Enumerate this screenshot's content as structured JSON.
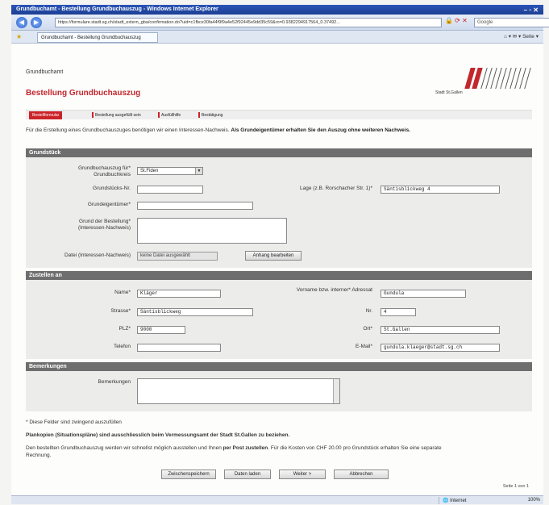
{
  "browser": {
    "title": "Grundbuchamt - Bestellung Grundbuchauszug - Windows Internet Explorer",
    "url": "https://formulare.stadt.sg.ch/stadt_extern_gba/confirmation.do?uid=c1fbce30fa44f9f9a4e52f92445e9dd35c59&ro=0.9382294917564_0.37492...",
    "search_placeholder": "Google",
    "tab_label": "Grundbuchamt - Bestellung Grundbuchauszug",
    "toolbar_right": "Seite",
    "status_zone": "Internet",
    "status_zoom": "100%"
  },
  "page": {
    "site_name": "Grundbuchamt",
    "title": "Bestellung Grundbuchauszug",
    "logo_text": "Stadt St.Gallen"
  },
  "steps": [
    {
      "label": "Bestellformular"
    },
    {
      "label": "Bestellung ausgefüllt sein"
    },
    {
      "label": "Ausfüllhilfe"
    },
    {
      "label": "Bestätigung"
    }
  ],
  "intro": {
    "text": "Für die Erstellung eines Grundbuchauszuges benötigen wir einen Interessen-Nachweis. ",
    "bold": "Als Grundeigentümer erhalten Sie den Auszug ohne weiteren Nachweis."
  },
  "grundstueck": {
    "heading": "Grundstück",
    "grundbuchauszug_label": "Grundbuchauszug für* Grundbuchkreis",
    "grundbuchauszug_value": "St.Fiden",
    "grundstueck_nr_label": "Grundstücks-Nr.",
    "grundstueck_nr_value": "",
    "lage_label": "Lage (z.B. Rorschacher Str. 1)*",
    "lage_value": "Säntisblickweg 4",
    "grundeigentuemer_label": "Grundeigentümer*",
    "grundeigentuemer_value": "",
    "grund_label": "Grund der Bestellung* (Interessen-Nachweis)",
    "datei_label": "Datei (Interessen-Nachweis)",
    "datei_value": "keine Datei ausgewählt",
    "anhang_button": "Anhang bearbeiten"
  },
  "zustellen": {
    "heading": "Zustellen an",
    "name_label": "Name*",
    "name_value": "Kläger",
    "vorname_label": "Vorname bzw. interner* Adressat",
    "vorname_value": "Gundula",
    "strasse_label": "Strasse*",
    "strasse_value": "Säntisblickweg",
    "nr_label": "Nr.",
    "nr_value": "4",
    "plz_label": "PLZ*",
    "plz_value": "9000",
    "ort_label": "Ort*",
    "ort_value": "St.Gallen",
    "telefon_label": "Telefon",
    "telefon_value": "",
    "email_label": "E-Mail*",
    "email_value": "gundula.klaeger@stadt.sg.ch"
  },
  "bemerkungen": {
    "heading": "Bemerkungen",
    "label": "Bemerkungen"
  },
  "footer": {
    "required_note": "* Diese Felder sind zwingend auszufüllen",
    "plankopien": "Plankopien (Situationspläne) sind ausschliesslich beim Vermessungsamt der Stadt St.Gallen zu beziehen.",
    "info_line1_pre": "Den bestellten Grundbuchauszug werden wir schnellst möglich ausstellen und Ihnen ",
    "info_line1_bold": "per Post zustellen",
    "info_line1_post": ". Für die Kosten von CHF 20.00 pro Grundstück erhalten Sie eine separate",
    "info_line2": "Rechnung.",
    "buttons": {
      "back": "Zwischenspeichern",
      "load": "Daten laden",
      "next": "Weiter >",
      "cancel": "Abbrechen"
    },
    "page_number": "Seite 1 von 1"
  }
}
